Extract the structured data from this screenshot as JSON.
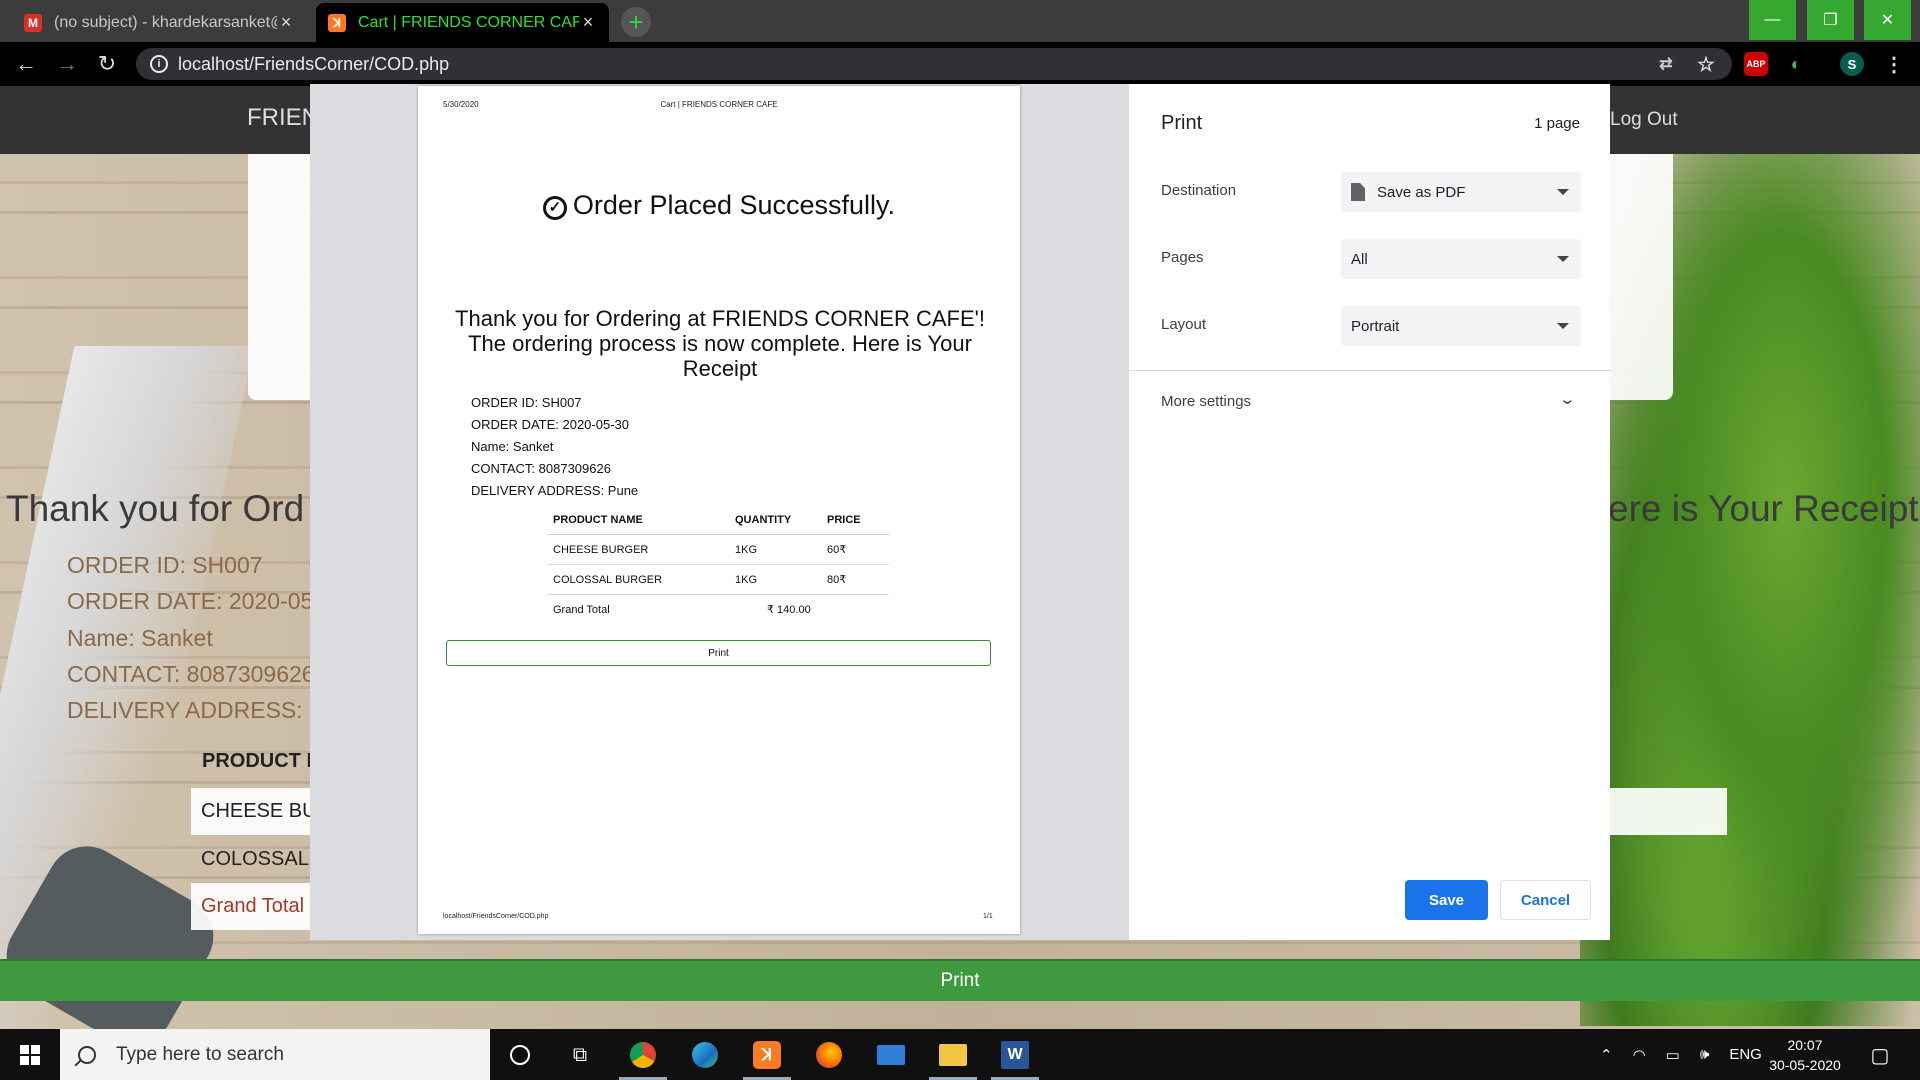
{
  "browser": {
    "tabs": [
      {
        "title": "(no subject) - khardekarsanket@",
        "favicon": "gmail-icon",
        "active": false
      },
      {
        "title": "Cart | FRIENDS CORNER CAFE",
        "favicon": "xampp-icon",
        "active": true
      }
    ],
    "url": "localhost/FriendsCorner/COD.php",
    "profile_initial": "S",
    "abp_label": "ABP"
  },
  "background_page": {
    "brand": "FRIEN",
    "logout": "Log Out",
    "thanks_left": "Thank you for Ord",
    "thanks_right": "ere is Your Receipt",
    "lines": [
      "ORDER ID: SH007",
      "ORDER DATE: 2020-05-",
      "Name: Sanket",
      "CONTACT: 8087309626",
      "DELIVERY ADDRESS: P"
    ],
    "product_header": "PRODUCT N",
    "rows": [
      "CHEESE BU",
      "COLOSSAL",
      "Grand Total"
    ],
    "print_label": "Print"
  },
  "print_preview": {
    "header_date": "5/30/2020",
    "header_title": "Cart | FRIENDS CORNER CAFE",
    "success": "Order Placed Successfully.",
    "thanks": "Thank you for Ordering at FRIENDS CORNER CAFE'! The ordering process is now complete. Here is Your Receipt",
    "order_id": "ORDER ID: SH007",
    "order_date": "ORDER DATE: 2020-05-30",
    "name": "Name: Sanket",
    "contact": "CONTACT: 8087309626",
    "address": "DELIVERY ADDRESS: Pune",
    "table": {
      "headers": [
        "PRODUCT NAME",
        "QUANTITY",
        "PRICE"
      ],
      "rows": [
        [
          "CHEESE BURGER",
          "1KG",
          "60₹"
        ],
        [
          "COLOSSAL BURGER",
          "1KG",
          "80₹"
        ]
      ],
      "grand_total_label": "Grand Total",
      "grand_total_value": "₹ 140.00"
    },
    "print_button": "Print",
    "footer_url": "localhost/FriendsCorner/COD.php",
    "footer_page": "1/1"
  },
  "print_dialog": {
    "title": "Print",
    "page_count": "1 page",
    "destination_label": "Destination",
    "destination_value": "Save as PDF",
    "pages_label": "Pages",
    "pages_value": "All",
    "layout_label": "Layout",
    "layout_value": "Portrait",
    "more_settings": "More settings",
    "save": "Save",
    "cancel": "Cancel"
  },
  "taskbar": {
    "search_placeholder": "Type here to search",
    "language": "ENG",
    "time": "20:07",
    "date": "30-05-2020"
  }
}
